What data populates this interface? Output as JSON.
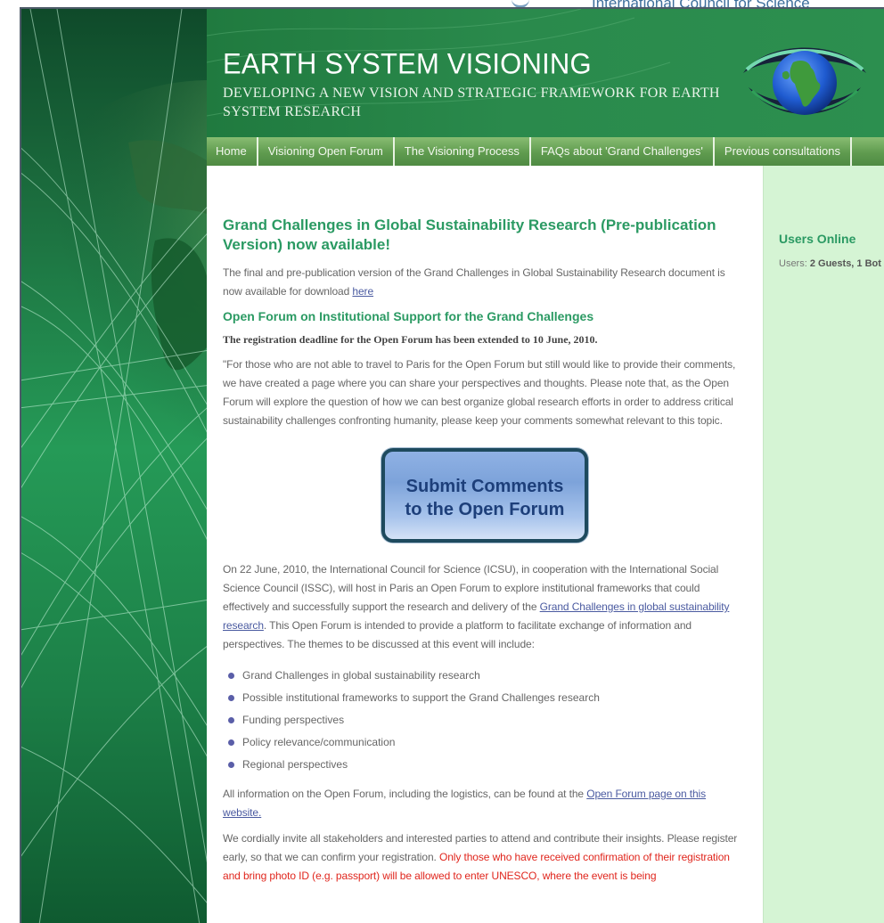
{
  "top_strip": {
    "org_text": "International Council for Science"
  },
  "header": {
    "title": "EARTH SYSTEM VISIONING",
    "tagline": "DEVELOPING A NEW VISION AND STRATEGIC FRAMEWORK FOR EARTH SYSTEM RESEARCH"
  },
  "nav": {
    "items": [
      {
        "label": "Home"
      },
      {
        "label": "Visioning Open Forum"
      },
      {
        "label": "The Visioning Process"
      },
      {
        "label": "FAQs about 'Grand Challenges'"
      },
      {
        "label": "Previous consultations"
      }
    ]
  },
  "main": {
    "headline": "Grand Challenges in Global Sustainability Research (Pre-publication Version) now available!",
    "intro_text": "The final and pre-publication version of the Grand Challenges in Global Sustainability Research document is now available for download ",
    "intro_link": "here",
    "forum_heading": "Open Forum on Institutional Support for the Grand Challenges",
    "deadline_notice": "The registration deadline for the Open Forum has been extended to 10 June, 2010.",
    "comments_text": "\"For those who are not able to travel to Paris for the Open Forum but still would like to provide their comments, we have created a page where you can share your perspectives and thoughts. Please note that, as the Open Forum will explore the question of how we can best organize global research efforts in order to address critical sustainability challenges confronting humanity, please keep your comments somewhat relevant to this topic.",
    "submit_button": {
      "line1": "Submit Comments",
      "line2": "to the Open Forum"
    },
    "event_text_1": "On 22 June, 2010, the International Council for Science (ICSU), in cooperation with the International Social Science Council (ISSC), will host in Paris an Open Forum to explore institutional frameworks that could effectively and successfully support the research and delivery of the ",
    "event_link": "Grand Challenges in global sustainability research",
    "event_text_2": ". This Open Forum is intended to provide a platform to facilitate exchange of information and perspectives. The themes to be discussed at this event will include:",
    "themes": [
      "Grand Challenges in global sustainability research",
      "Possible institutional frameworks to support the Grand Challenges research",
      "Funding perspectives",
      "Policy relevance/communication",
      "Regional perspectives"
    ],
    "info_text": "All information on the Open Forum, including the logistics, can be found at the ",
    "info_link": "Open Forum page on this website.",
    "cordial_text": "We cordially invite all stakeholders and interested parties to attend and contribute their insights. Please register early, so that we can confirm your registration. ",
    "cordial_red": "Only those who have received confirmation of their registration and bring photo ID (e.g. passport) will be allowed to enter UNESCO, where the event is being"
  },
  "sidebar": {
    "users_online_title": "Users Online",
    "users_label": "Users: ",
    "users_value": "2 Guests, 1 Bot"
  },
  "colors": {
    "header_green": "#2a8a4c",
    "nav_green": "#5f9b4f",
    "heading_green": "#2b9a63",
    "sidebar_bg": "#d5f4d4",
    "link_blue": "#4a5aa0",
    "warning_red": "#e0261d",
    "button_border": "#1e4a5e"
  }
}
